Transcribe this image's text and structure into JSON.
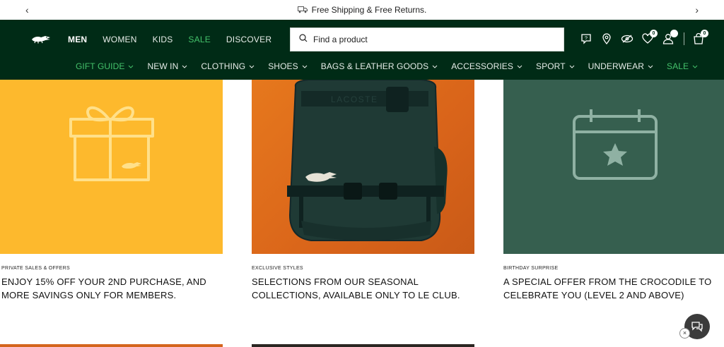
{
  "promo": {
    "text": "Free Shipping & Free Returns."
  },
  "header": {
    "main_nav": [
      {
        "label": "MEN",
        "active": true
      },
      {
        "label": "WOMEN"
      },
      {
        "label": "KIDS"
      },
      {
        "label": "SALE",
        "highlight": true
      },
      {
        "label": "DISCOVER"
      }
    ],
    "search": {
      "placeholder": "Find a product"
    },
    "icons": [
      "help-icon",
      "store-locator-icon",
      "le-club-icon",
      "wishlist-icon",
      "account-icon",
      "cart-icon"
    ],
    "wishlist_count": "0",
    "cart_count": "0",
    "sub_nav": [
      {
        "label": "GIFT GUIDE",
        "highlight": true
      },
      {
        "label": "NEW IN"
      },
      {
        "label": "CLOTHING"
      },
      {
        "label": "SHOES"
      },
      {
        "label": "BAGS & LEATHER GOODS"
      },
      {
        "label": "ACCESSORIES"
      },
      {
        "label": "SPORT"
      },
      {
        "label": "UNDERWEAR"
      },
      {
        "label": "SALE",
        "highlight": true
      }
    ]
  },
  "cards": [
    {
      "eyebrow": "PRIVATE SALES & OFFERS",
      "title": "ENJOY 15% OFF YOUR 2ND PURCHASE, AND MORE SAVINGS ONLY FOR MEMBERS.",
      "bg": "#fdb92d",
      "icon": "gift-icon"
    },
    {
      "eyebrow": "EXCLUSIVE STYLES",
      "title": "SELECTIONS FROM OUR SEASONAL COLLECTIONS, AVAILABLE ONLY TO LE CLUB.",
      "bg": "#e0701b",
      "image_text": "LACOSTE",
      "icon": "backpack-image"
    },
    {
      "eyebrow": "BIRTHDAY SURPRISE",
      "title": "A SPECIAL OFFER FROM THE CROCODILE TO CELEBRATE YOU (LEVEL 2 AND ABOVE)",
      "bg": "#365f4f",
      "icon": "calendar-star-icon"
    }
  ],
  "colors": {
    "header_bg": "#002b16",
    "accent_green": "#44c16b"
  },
  "chat": {
    "close_label": "×"
  }
}
